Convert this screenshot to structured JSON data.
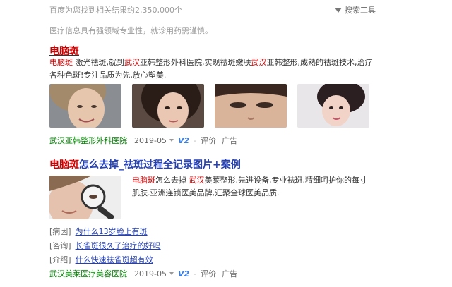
{
  "top": {
    "result_count": "百度为您找到相关结果约2,350,000个",
    "tools_label": "搜索工具",
    "notice": "医疗信息具有强领域专业性，就诊用药需谨慎。"
  },
  "result1": {
    "title_highlight": "电脑斑",
    "title_rest": "",
    "desc_line1": [
      {
        "t": "电脑斑",
        "hl": true
      },
      {
        "t": " 激光祛斑,就到",
        "hl": false
      },
      {
        "t": "武汉",
        "hl": true
      },
      {
        "t": "亚韩整形外科医院,实现祛斑嫩肤",
        "hl": false
      },
      {
        "t": "武汉",
        "hl": true
      },
      {
        "t": "亚韩整形,成熟的祛斑技术,治疗",
        "hl": false
      }
    ],
    "desc_line2": "各种色斑!专注品质为先,放心塑美.",
    "site": "武汉亚韩整形外科医院",
    "date": "2019-05",
    "v_badge": "V2",
    "review": "评价",
    "ad": "广告"
  },
  "result2": {
    "title_highlight": "电脑斑",
    "title_rest": "怎么去掉_祛斑过程全记录图片+案例",
    "desc_line1": [
      {
        "t": "电脑斑",
        "hl": true
      },
      {
        "t": "怎么去掉 ",
        "hl": false
      },
      {
        "t": "武汉",
        "hl": true
      },
      {
        "t": "美莱整形,先进设备,专业祛斑,精细呵护你的每寸",
        "hl": false
      }
    ],
    "desc_line2": "肌肤.亚洲连锁医美品牌,汇聚全球医美品质.",
    "sublinks": [
      {
        "tag": "[病因]",
        "text": "为什么13岁脸上有斑"
      },
      {
        "tag": "[咨询]",
        "text": "长雀斑很久了治疗的好吗"
      },
      {
        "tag": "[介绍]",
        "text": "什么快速祛雀斑超有效"
      }
    ],
    "site": "武汉美莱医疗美容医院",
    "date": "2019-05",
    "v_badge": "V2",
    "review": "评价",
    "ad": "广告"
  }
}
